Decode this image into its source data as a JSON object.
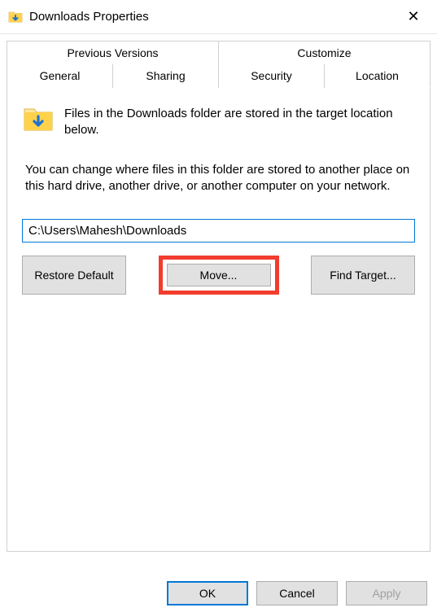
{
  "window": {
    "title": "Downloads Properties",
    "close_glyph": "✕"
  },
  "tabs": {
    "row1": [
      "Previous Versions",
      "Customize"
    ],
    "row2": [
      "General",
      "Sharing",
      "Security",
      "Location"
    ],
    "active": "Location"
  },
  "location_tab": {
    "info_text": "Files in the Downloads folder are stored in the target location below.",
    "desc_text": "You can change where files in this folder are stored to another place on this hard drive, another drive, or another computer on your network.",
    "path_value": "C:\\Users\\Mahesh\\Downloads",
    "buttons": {
      "restore": "Restore Default",
      "move": "Move...",
      "find": "Find Target..."
    }
  },
  "footer": {
    "ok": "OK",
    "cancel": "Cancel",
    "apply": "Apply"
  }
}
